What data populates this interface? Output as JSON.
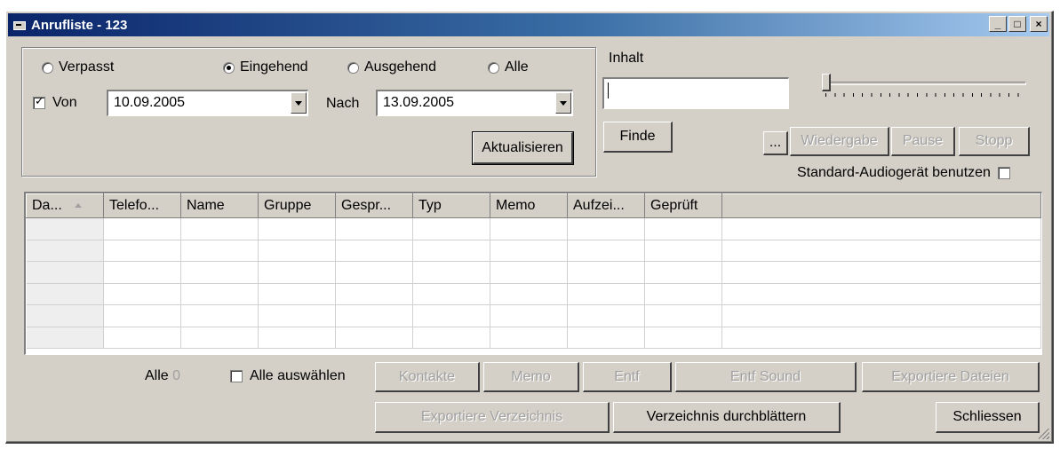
{
  "window": {
    "title": "Anrufliste - 123",
    "controls": {
      "minimize": "_",
      "maximize": "□",
      "close": "×"
    }
  },
  "filter": {
    "radios": [
      {
        "label": "Verpasst",
        "selected": false
      },
      {
        "label": "Eingehend",
        "selected": true
      },
      {
        "label": "Ausgehend",
        "selected": false
      },
      {
        "label": "Alle",
        "selected": false
      }
    ],
    "from_checkbox_label": "Von",
    "from_checked": true,
    "from_date": "10.09.2005",
    "to_label": "Nach",
    "to_date": "13.09.2005",
    "refresh_button": "Aktualisieren"
  },
  "search": {
    "label": "Inhalt",
    "value": "",
    "find_button": "Finde"
  },
  "playback": {
    "browse_button": "...",
    "play_button": "Wiedergabe",
    "pause_button": "Pause",
    "stop_button": "Stopp",
    "default_audio_label": "Standard-Audiogerät benutzen",
    "default_audio_checked": false
  },
  "table": {
    "columns": [
      "Da...",
      "Telefo...",
      "Name",
      "Gruppe",
      "Gespr...",
      "Typ",
      "Memo",
      "Aufzei...",
      "Geprüft"
    ],
    "sorted_column": "Da...",
    "row_count": 6
  },
  "footer": {
    "all_label": "Alle",
    "all_count": "0",
    "select_all_label": "Alle auswählen",
    "select_all_checked": false,
    "contacts_button": "Kontakte",
    "memo_button": "Memo",
    "delete_button": "Entf",
    "delete_sound_button": "Entf Sound",
    "export_files_button": "Exportiere Dateien",
    "export_directory_button": "Exportiere Verzeichnis",
    "browse_directory_button": "Verzeichnis durchblättern",
    "close_button": "Schliessen"
  }
}
